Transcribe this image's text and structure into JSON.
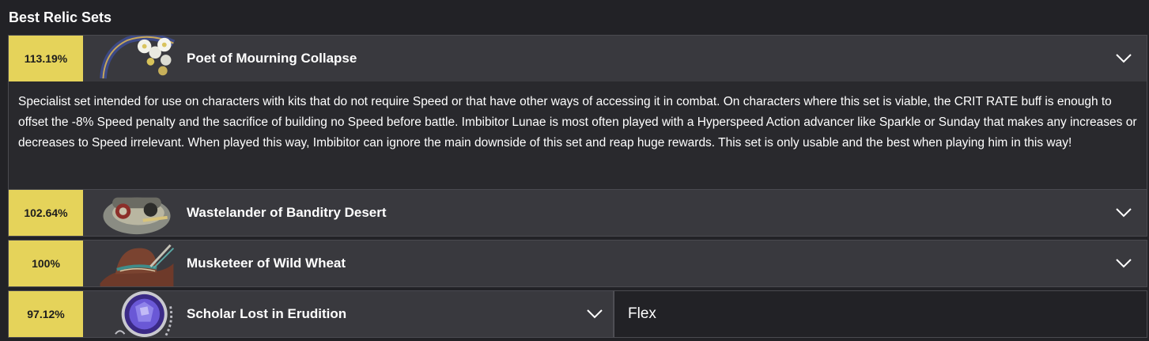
{
  "section_title": "Best Relic Sets",
  "relic_sets": [
    {
      "percent": "113.19%",
      "name": "Poet of Mourning Collapse",
      "expanded": true,
      "icon": "flower-wreath-relic-icon",
      "description": "Specialist set intended for use on characters with kits that do not require Speed or that have other ways of accessing it in combat. On characters where this set is viable, the CRIT RATE buff is enough to offset the -8% Speed penalty and the sacrifice of building no Speed before battle. Imbibitor Lunae is most often played with a Hyperspeed Action advancer like Sparkle or Sunday that makes any increases or decreases to Speed irrelevant. When played this way, Imbibitor can ignore the main downside of this set and reap huge rewards. This set is only usable and the best when playing him in this way!"
    },
    {
      "percent": "102.64%",
      "name": "Wastelander of Banditry Desert",
      "expanded": false,
      "icon": "goggles-helmet-relic-icon"
    },
    {
      "percent": "100%",
      "name": "Musketeer of Wild Wheat",
      "expanded": false,
      "icon": "cowboy-hat-relic-icon"
    },
    {
      "percent": "97.12%",
      "name": "Scholar Lost in Erudition",
      "expanded": false,
      "icon": "purple-gem-relic-icon",
      "extra_label": "Flex"
    }
  ],
  "colors": {
    "percent_badge": "#e5d35a",
    "row_bg": "#39393e",
    "page_bg": "#222226"
  }
}
